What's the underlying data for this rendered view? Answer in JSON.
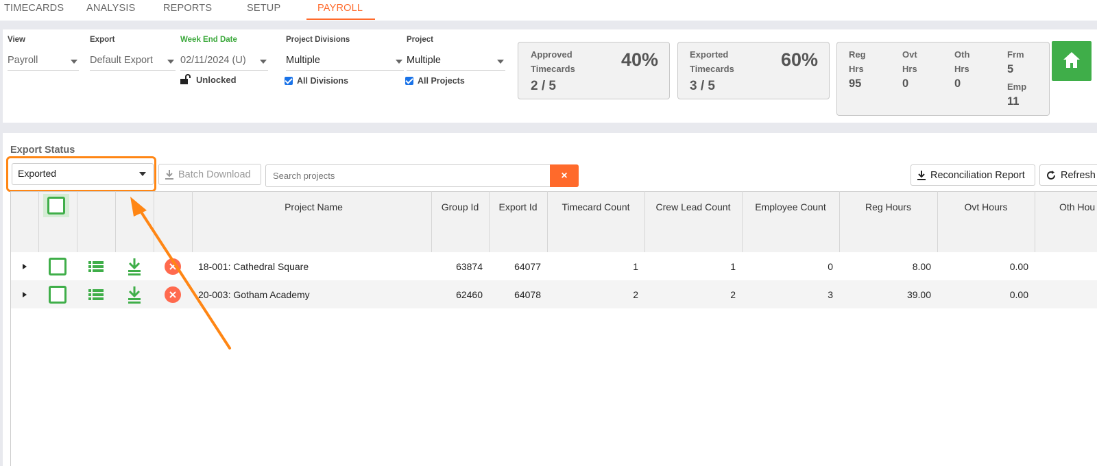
{
  "nav": {
    "tabs": [
      {
        "label": "TIMECARDS",
        "active": false
      },
      {
        "label": "ANALYSIS",
        "active": false
      },
      {
        "label": "REPORTS",
        "active": false
      },
      {
        "label": "SETUP",
        "active": false
      },
      {
        "label": "PAYROLL",
        "active": true
      }
    ]
  },
  "filters": {
    "view": {
      "label": "View",
      "value": "Payroll"
    },
    "export": {
      "label": "Export",
      "value": "Default Export"
    },
    "week_end": {
      "label": "Week End Date",
      "value": "02/11/2024 (U)",
      "lock_status": "Unlocked"
    },
    "divisions": {
      "label": "Project Divisions",
      "value": "Multiple",
      "checkbox_label": "All Divisions",
      "checked": true
    },
    "project": {
      "label": "Project",
      "value": "Multiple",
      "checkbox_label": "All Projects",
      "checked": true
    }
  },
  "stats": {
    "approved": {
      "line1": "Approved",
      "line2": "Timecards",
      "percent": "40%",
      "fraction": "2 / 5"
    },
    "exported": {
      "line1": "Exported",
      "line2": "Timecards",
      "percent": "60%",
      "fraction": "3 / 5"
    },
    "hours": {
      "reg": {
        "l1": "Reg",
        "l2": "Hrs",
        "value": "95"
      },
      "ovt": {
        "l1": "Ovt",
        "l2": "Hrs",
        "value": "0"
      },
      "oth": {
        "l1": "Oth",
        "l2": "Hrs",
        "value": "0"
      },
      "frm": {
        "l1": "Frm",
        "value": "5"
      },
      "emp": {
        "l1": "Emp",
        "value": "11"
      }
    }
  },
  "export_status": {
    "title": "Export Status",
    "selected": "Exported",
    "batch_download": "Batch Download",
    "search_placeholder": "Search projects",
    "clear_symbol": "×",
    "reconciliation": "Reconciliation Report",
    "refresh": "Refresh"
  },
  "table": {
    "columns": [
      "Project Name",
      "Group Id",
      "Export Id",
      "Timecard Count",
      "Crew Lead Count",
      "Employee Count",
      "Reg Hours",
      "Ovt Hours",
      "Oth Hou"
    ],
    "rows": [
      {
        "project": "18-001: Cathedral Square",
        "group_id": "63874",
        "export_id": "64077",
        "timecards": "1",
        "crew_leads": "1",
        "employees": "0",
        "reg": "8.00",
        "ovt": "0.00"
      },
      {
        "project": "20-003: Gotham Academy",
        "group_id": "62460",
        "export_id": "64078",
        "timecards": "2",
        "crew_leads": "2",
        "employees": "3",
        "reg": "39.00",
        "ovt": "0.00"
      }
    ]
  },
  "colors": {
    "accent_orange": "#ff6a2b",
    "highlight_orange": "#ff8614",
    "green": "#3fae49",
    "red_cancel": "#ff6a4e"
  }
}
